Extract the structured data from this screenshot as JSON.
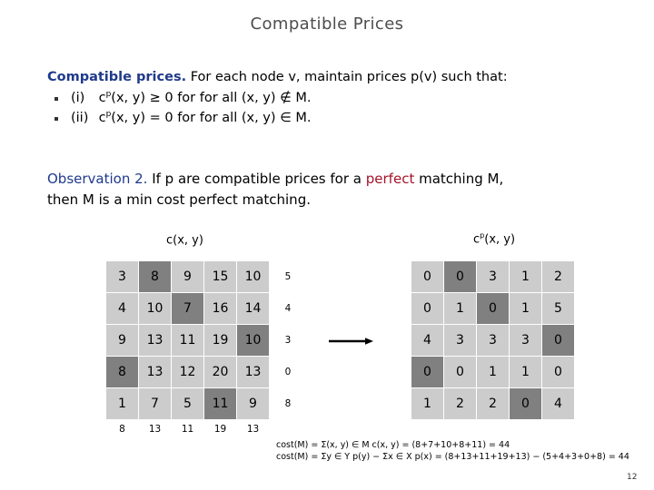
{
  "slide": {
    "title": "Compatible Prices",
    "page_number": "12"
  },
  "definition": {
    "lead": "Compatible prices.",
    "rest": "For each node v, maintain prices p(v) such that:",
    "bullets": [
      {
        "label": "(i)",
        "expr_prefix": "c",
        "expr_sup": "p",
        "expr_rest": "(x, y) ≥ 0 for for all (x, y) ∉ M."
      },
      {
        "label": "(ii)",
        "expr_prefix": "c",
        "expr_sup": "p",
        "expr_rest": "(x, y) = 0 for for all (x, y) ∈ M."
      }
    ]
  },
  "observation": {
    "head": "Observation 2.",
    "part1": "If p are compatible prices for a",
    "emphasis": "perfect",
    "part2": "matching M,",
    "line2": "then M is a min cost perfect matching."
  },
  "matrices": {
    "left": {
      "caption_main": "c",
      "caption_sup": "",
      "caption_rest": "(x, y)",
      "rows": [
        {
          "values": [
            "3",
            "8",
            "9",
            "15",
            "10"
          ],
          "highlight": [
            false,
            true,
            false,
            false,
            false
          ],
          "row_label": "5"
        },
        {
          "values": [
            "4",
            "10",
            "7",
            "16",
            "14"
          ],
          "highlight": [
            false,
            false,
            true,
            false,
            false
          ],
          "row_label": "4"
        },
        {
          "values": [
            "9",
            "13",
            "11",
            "19",
            "10"
          ],
          "highlight": [
            false,
            false,
            false,
            false,
            true
          ],
          "row_label": "3"
        },
        {
          "values": [
            "8",
            "13",
            "12",
            "20",
            "13"
          ],
          "highlight": [
            true,
            false,
            false,
            false,
            false
          ],
          "row_label": "0"
        },
        {
          "values": [
            "1",
            "7",
            "5",
            "11",
            "9"
          ],
          "highlight": [
            false,
            false,
            false,
            true,
            false
          ],
          "row_label": "8"
        }
      ],
      "col_labels": [
        "8",
        "13",
        "11",
        "19",
        "13"
      ]
    },
    "right": {
      "caption_main": "c",
      "caption_sup": "p",
      "caption_rest": "(x, y)",
      "rows": [
        {
          "values": [
            "0",
            "0",
            "3",
            "1",
            "2"
          ],
          "highlight": [
            false,
            true,
            false,
            false,
            false
          ],
          "row_label": ""
        },
        {
          "values": [
            "0",
            "1",
            "0",
            "1",
            "5"
          ],
          "highlight": [
            false,
            false,
            true,
            false,
            false
          ],
          "row_label": ""
        },
        {
          "values": [
            "4",
            "3",
            "3",
            "3",
            "0"
          ],
          "highlight": [
            false,
            false,
            false,
            false,
            true
          ],
          "row_label": ""
        },
        {
          "values": [
            "0",
            "0",
            "1",
            "1",
            "0"
          ],
          "highlight": [
            true,
            false,
            false,
            false,
            false
          ],
          "row_label": ""
        },
        {
          "values": [
            "1",
            "2",
            "2",
            "0",
            "4"
          ],
          "highlight": [
            false,
            false,
            false,
            true,
            false
          ],
          "row_label": ""
        }
      ],
      "col_labels": [
        "",
        "",
        "",
        "",
        ""
      ]
    }
  },
  "cost_equations": {
    "line1": "cost(M) = Σ(x, y) ∈ M c(x, y) = (8+7+10+8+11) = 44",
    "line2": "cost(M) = Σy ∈ Y p(y)  −  Σx ∈ X p(x) = (8+13+11+19+13) − (5+4+3+0+8) = 44"
  },
  "arrow": {
    "name": "transform-arrow",
    "color": "#000000"
  }
}
